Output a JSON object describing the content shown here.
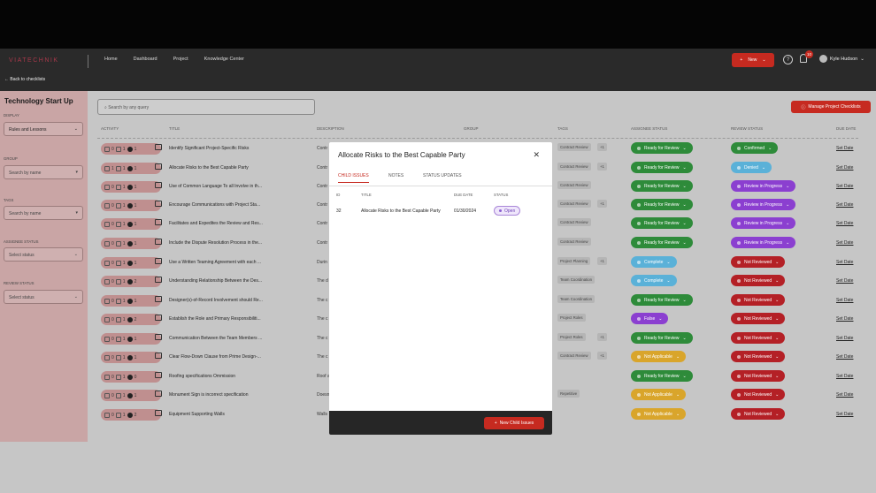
{
  "nav": {
    "logo": "VIATECHNIK",
    "links": [
      "Home",
      "Dashboard",
      "Project",
      "Knowledge Center"
    ],
    "back_label": "Back to checklists",
    "new_label": "New",
    "notifications": "10",
    "user_name": "Kyle Hudson"
  },
  "sidebar": {
    "title": "Technology Start Up",
    "display_label": "DISPLAY",
    "display_value": "Rules and Lessons",
    "group_label": "GROUP",
    "group_placeholder": "Search by name",
    "tags_label": "TAGS",
    "tags_placeholder": "Search by name",
    "assignee_label": "ASSIGNEE STATUS",
    "assignee_placeholder": "Select status",
    "review_label": "REVIEW STATUS",
    "review_placeholder": "Select status"
  },
  "search_placeholder": "Search by any query",
  "manage_label": "Manage Project Checklists",
  "columns": [
    "ACTIVITY",
    "TITLE",
    "DESCRIPTION",
    "GROUP",
    "TAGS",
    "ASSIGNEE STATUS",
    "REVIEW STATUS",
    "DUE DATE"
  ],
  "colors": {
    "green": "#2e8b3a",
    "blue": "#5ab1d8",
    "purple": "#8b3fd0",
    "red": "#b42026",
    "yellow": "#d9a52b",
    "accent": "#c62a20"
  },
  "rows": [
    {
      "c1": "0",
      "c2": "1",
      "c3": "1",
      "title": "Identify Significant Project-Specific Risks",
      "desc": "Contr",
      "tag": "Contract Review",
      "count": "+1",
      "assignee": "Ready for Review",
      "acolor": "green",
      "review": "Confirmed",
      "rcolor": "green",
      "due": "Set Date"
    },
    {
      "c1": "1",
      "c2": "1",
      "c3": "1",
      "title": "Allocate Risks to the Best Capable Party",
      "desc": "Contr",
      "tag": "Contract Review",
      "count": "+1",
      "assignee": "Ready for Review",
      "acolor": "green",
      "review": "Denied",
      "rcolor": "blue",
      "due": "Set Date"
    },
    {
      "c1": "0",
      "c2": "1",
      "c3": "1",
      "title": "Use of Common Language To all Involve in th...",
      "desc": "Contr",
      "tag": "Contract Review",
      "count": "",
      "assignee": "Ready for Review",
      "acolor": "green",
      "review": "Review in Progress",
      "rcolor": "purple",
      "due": "Set Date"
    },
    {
      "c1": "0",
      "c2": "1",
      "c3": "1",
      "title": "Encourage Communications with Project Sta...",
      "desc": "Contr",
      "tag": "Contract Review",
      "count": "+1",
      "assignee": "Ready for Review",
      "acolor": "green",
      "review": "Review in Progress",
      "rcolor": "purple",
      "due": "Set Date"
    },
    {
      "c1": "0",
      "c2": "1",
      "c3": "1",
      "title": "Facilitates and Expedites the Review and Res...",
      "desc": "Contr",
      "tag": "Contract Review",
      "count": "",
      "assignee": "Ready for Review",
      "acolor": "green",
      "review": "Review in Progress",
      "rcolor": "purple",
      "due": "Set Date"
    },
    {
      "c1": "0",
      "c2": "1",
      "c3": "1",
      "title": "Include the Dispute Resolution Process in the...",
      "desc": "Contr",
      "tag": "Contract Review",
      "count": "",
      "assignee": "Ready for Review",
      "acolor": "green",
      "review": "Review in Progress",
      "rcolor": "purple",
      "due": "Set Date"
    },
    {
      "c1": "0",
      "c2": "1",
      "c3": "1",
      "title": "Use a Written Teaming Agreement with each ...",
      "desc": "Durin",
      "tag": "Project Planning",
      "count": "+1",
      "assignee": "Complete",
      "acolor": "blue",
      "review": "Not Reviewed",
      "rcolor": "red",
      "due": "Set Date"
    },
    {
      "c1": "0",
      "c2": "1",
      "c3": "2",
      "title": "Understanding Relationship Between the Des...",
      "desc": "The d",
      "tag": "Team Coordination",
      "count": "",
      "assignee": "Complete",
      "acolor": "blue",
      "review": "Not Reviewed",
      "rcolor": "red",
      "due": "Set Date"
    },
    {
      "c1": "0",
      "c2": "1",
      "c3": "1",
      "title": "Designer(s)-of-Record Involvement should Re...",
      "desc": "The c",
      "tag": "Team Coordination",
      "count": "",
      "assignee": "Ready for Review",
      "acolor": "green",
      "review": "Not Reviewed",
      "rcolor": "red",
      "due": "Set Date"
    },
    {
      "c1": "0",
      "c2": "1",
      "c3": "2",
      "title": "Establish the Role and Primary Responsibiliti...",
      "desc": "The c",
      "tag": "Project Roles",
      "count": "",
      "assignee": "False",
      "acolor": "purple",
      "review": "Not Reviewed",
      "rcolor": "red",
      "due": "Set Date"
    },
    {
      "c1": "0",
      "c2": "1",
      "c3": "1",
      "title": "Communication Between the Team Members ...",
      "desc": "The c",
      "tag": "Project Roles",
      "count": "+1",
      "assignee": "Ready for Review",
      "acolor": "green",
      "review": "Not Reviewed",
      "rcolor": "red",
      "due": "Set Date"
    },
    {
      "c1": "0",
      "c2": "1",
      "c3": "1",
      "title": "Clear Flow-Down Clause from Prime Design-...",
      "desc": "The c",
      "tag": "Contract Review",
      "count": "+1",
      "assignee": "Not Applicable",
      "acolor": "yellow",
      "review": "Not Reviewed",
      "rcolor": "red",
      "due": "Set Date"
    },
    {
      "c1": "0",
      "c2": "1",
      "c3": "0",
      "title": "Roofing specifications Ommission",
      "desc": "Roof a",
      "tag": "",
      "count": "",
      "assignee": "Ready for Review",
      "acolor": "green",
      "review": "Not Reviewed",
      "rcolor": "red",
      "due": "Set Date"
    },
    {
      "c1": "0",
      "c2": "1",
      "c3": "1",
      "title": "Monument Sign is incorrect specification",
      "desc": "Doesn",
      "tag": "Repetitive",
      "count": "",
      "assignee": "Not Applicable",
      "acolor": "yellow",
      "review": "Not Reviewed",
      "rcolor": "red",
      "due": "Set Date"
    },
    {
      "c1": "0",
      "c2": "1",
      "c3": "2",
      "title": "Equipment Supporting Walls",
      "desc": "Walls",
      "tag": "",
      "count": "",
      "assignee": "Not Applicable",
      "acolor": "yellow",
      "review": "Not Reviewed",
      "rcolor": "red",
      "due": "Set Date"
    }
  ],
  "modal": {
    "title": "Allocate Risks to the Best Capable Party",
    "tabs": [
      "CHILD ISSUES",
      "NOTES",
      "STATUS UPDATES"
    ],
    "headers": [
      "ID",
      "TITLE",
      "DUE DATE",
      "STATUS"
    ],
    "row": {
      "id": "32",
      "title": "Allocate Risks to the Best Capable Party",
      "due": "01/30/2024",
      "status": "Open"
    },
    "new_child_label": "New Child Issues"
  }
}
